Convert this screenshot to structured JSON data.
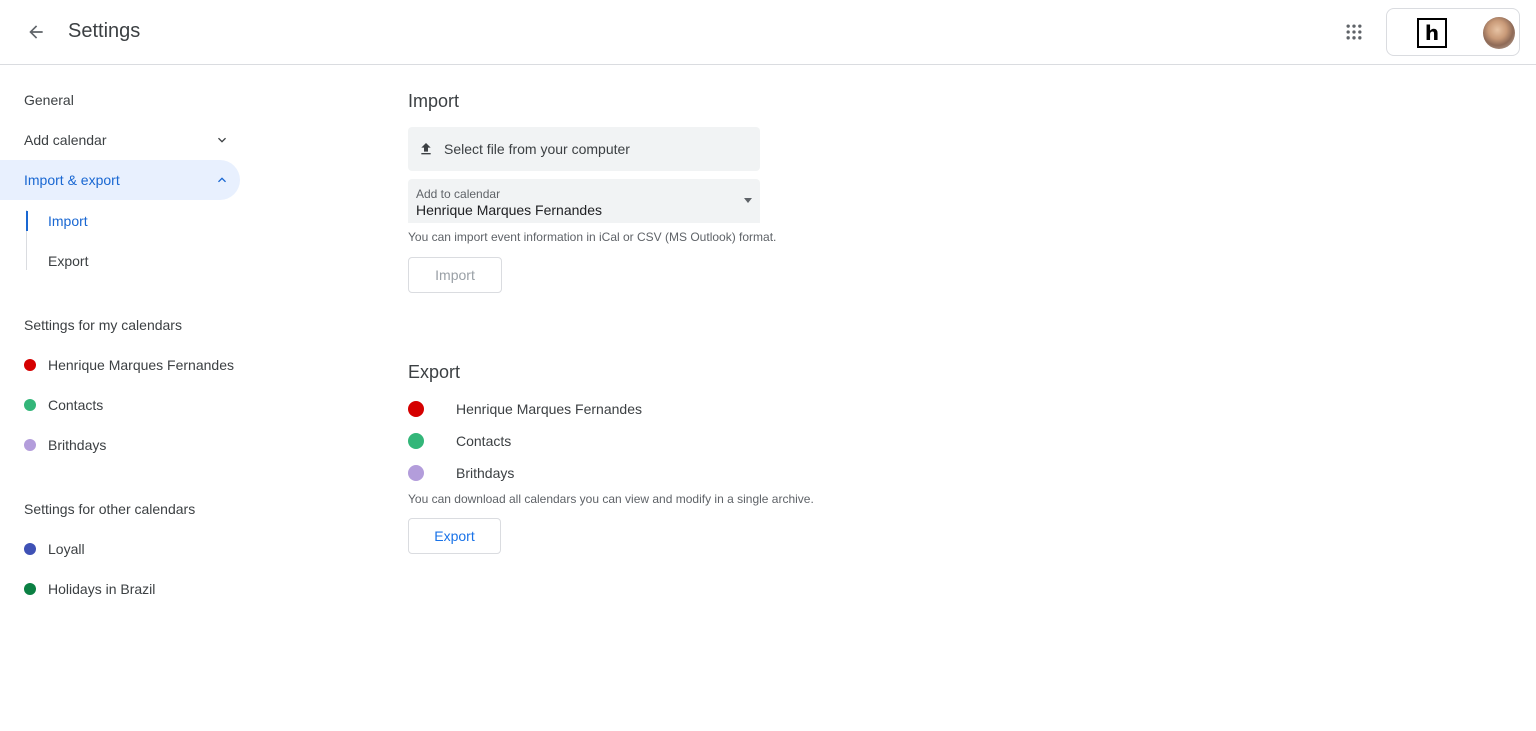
{
  "header": {
    "title": "Settings",
    "brand_letter": "h"
  },
  "sidebar": {
    "general": "General",
    "add_calendar": "Add calendar",
    "import_export": "Import & export",
    "sub_import": "Import",
    "sub_export": "Export",
    "my_calendars_heading": "Settings for my calendars",
    "my_calendars": [
      {
        "label": "Henrique Marques Fernandes",
        "color": "#d50000"
      },
      {
        "label": "Contacts",
        "color": "#33b679"
      },
      {
        "label": "Brithdays",
        "color": "#b39ddb"
      }
    ],
    "other_calendars_heading": "Settings for other calendars",
    "other_calendars": [
      {
        "label": "Loyall",
        "color": "#3f51b5"
      },
      {
        "label": "Holidays in Brazil",
        "color": "#0b8043"
      }
    ]
  },
  "import": {
    "heading": "Import",
    "file_picker_label": "Select file from your computer",
    "add_to_label": "Add to calendar",
    "add_to_value": "Henrique Marques Fernandes",
    "helper": "You can import event information in iCal or CSV (MS Outlook) format.",
    "button": "Import"
  },
  "export": {
    "heading": "Export",
    "calendars": [
      {
        "label": "Henrique Marques Fernandes",
        "color": "#d50000"
      },
      {
        "label": "Contacts",
        "color": "#33b679"
      },
      {
        "label": "Brithdays",
        "color": "#b39ddb"
      }
    ],
    "helper": "You can download all calendars you can view and modify in a single archive.",
    "button": "Export"
  }
}
